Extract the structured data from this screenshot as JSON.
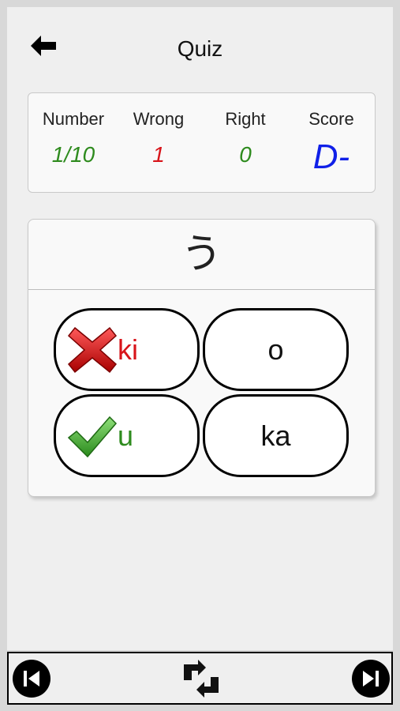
{
  "header": {
    "title": "Quiz",
    "back_icon": "arrow-left-icon"
  },
  "stats": {
    "number": {
      "label": "Number",
      "value": "1/10",
      "color": "#2e8b1e"
    },
    "wrong": {
      "label": "Wrong",
      "value": "1",
      "color": "#d8141a"
    },
    "right": {
      "label": "Right",
      "value": "0",
      "color": "#2e8b1e"
    },
    "score": {
      "label": "Score",
      "value": "D-",
      "color": "#1020e8"
    }
  },
  "quiz": {
    "kana": "う",
    "answers": [
      {
        "text": "ki",
        "state": "wrong",
        "color": "#d8141a",
        "icon": "red-x-icon"
      },
      {
        "text": "o",
        "state": "neutral",
        "color": "#111111"
      },
      {
        "text": "u",
        "state": "correct",
        "color": "#2e8b1e",
        "icon": "green-check-icon"
      },
      {
        "text": "ka",
        "state": "neutral",
        "color": "#111111"
      }
    ]
  },
  "footer": {
    "prev_icon": "skip-previous-icon",
    "swap_icon": "swap-arrows-icon",
    "next_icon": "skip-next-icon"
  }
}
